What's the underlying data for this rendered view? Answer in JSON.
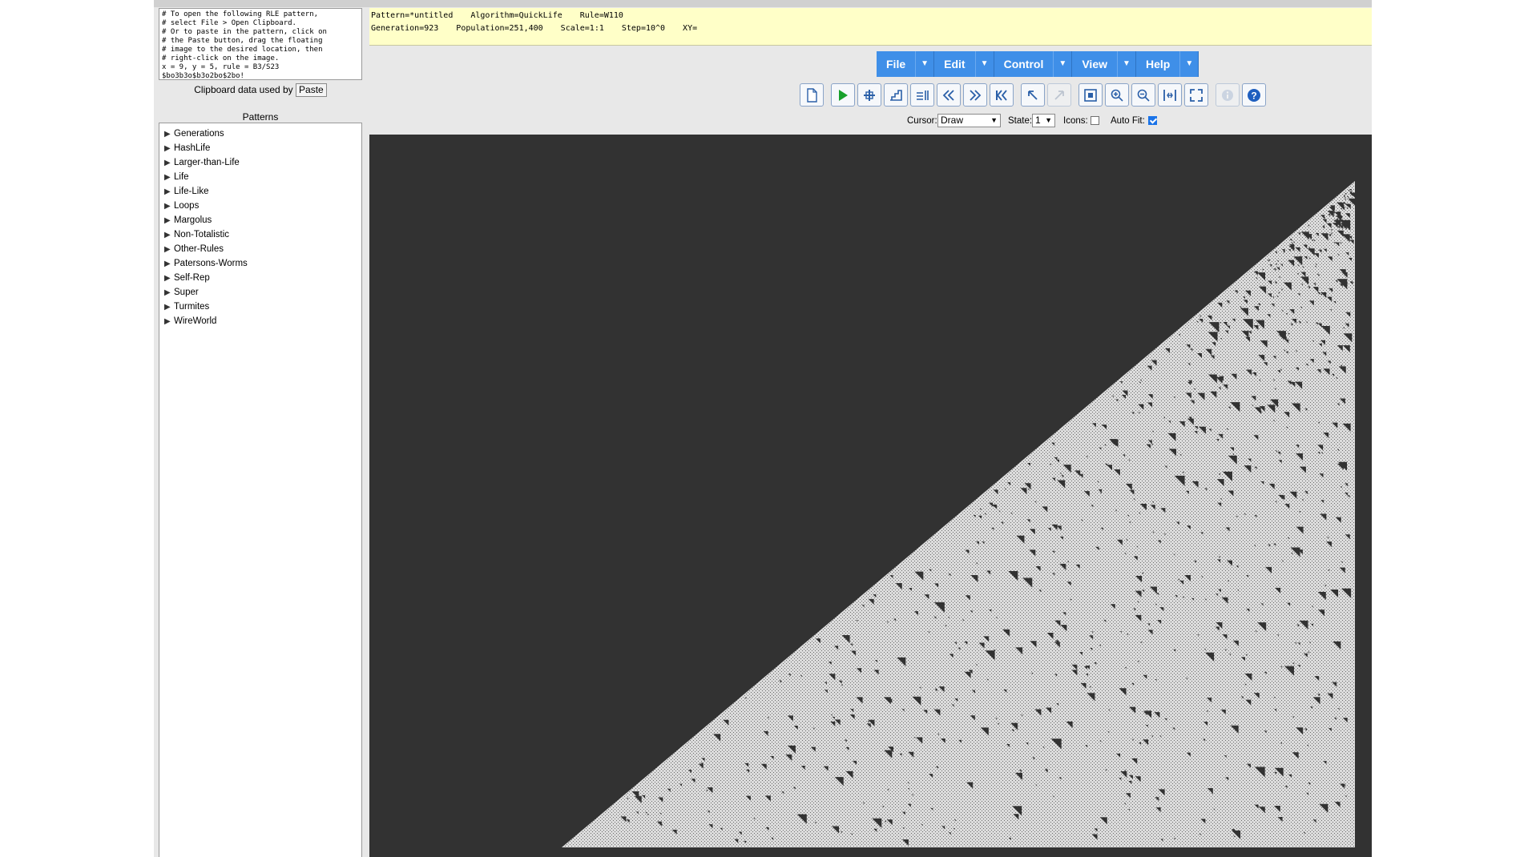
{
  "clipboard": {
    "text": "# To open the following RLE pattern,\n# select File > Open Clipboard.\n# Or to paste in the pattern, click on\n# the Paste button, drag the floating\n# image to the desired location, then\n# right-click on the image.\nx = 9, y = 5, rule = B3/S23\n$bo3b3o$b3o2bo$2bo!",
    "caption": "Clipboard data used by",
    "paste_label": "Paste"
  },
  "patterns": {
    "title": "Patterns",
    "items": [
      "Generations",
      "HashLife",
      "Larger-than-Life",
      "Life",
      "Life-Like",
      "Loops",
      "Margolus",
      "Non-Totalistic",
      "Other-Rules",
      "Patersons-Worms",
      "Self-Rep",
      "Super",
      "Turmites",
      "WireWorld"
    ]
  },
  "info": {
    "pattern": "Pattern=*untitled",
    "algorithm": "Algorithm=QuickLife",
    "rule": "Rule=W110",
    "generation": "Generation=923",
    "population": "Population=251,400",
    "scale": "Scale=1:1",
    "step": "Step=10^0",
    "xy": "XY="
  },
  "menu": [
    "File",
    "Edit",
    "Control",
    "View",
    "Help"
  ],
  "toolbar_icons": [
    "new-pattern-icon",
    "start-icon",
    "next-generation-icon",
    "next-step-icon",
    "reset-icon",
    "slower-icon",
    "faster-icon",
    "reset-to-start-icon",
    "undo-icon",
    "redo-icon",
    "fit-icon",
    "zoom-in-icon",
    "zoom-out-icon",
    "middle-icon",
    "full-screen-icon",
    "info-icon",
    "help-icon"
  ],
  "options": {
    "cursor_label": "Cursor:",
    "cursor_value": "Draw",
    "state_label": "State:",
    "state_value": "1",
    "icons_label": "Icons:",
    "icons_checked": false,
    "autofit_label": "Auto Fit:",
    "autofit_checked": true
  },
  "colors": {
    "canvas_bg": "#323232",
    "live_cell": "#dcdcdc",
    "menu_bg": "#3f8fe8",
    "info_bg": "#ffffc8"
  }
}
